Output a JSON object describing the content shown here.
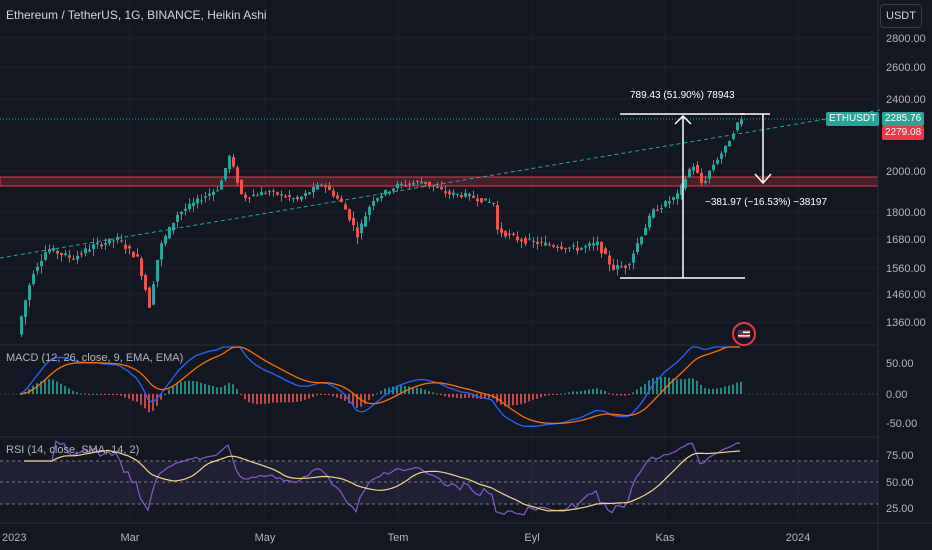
{
  "header": {
    "title": "Ethereum / TetherUS, 1G, BINANCE, Heikin Ashi",
    "currency_button": "USDT"
  },
  "indicators": {
    "macd_label": "MACD (12, 26, close, 9, EMA, EMA)",
    "rsi_label": "RSI (14, close, SMA, 14, 2)"
  },
  "axes": {
    "price_ticks": [
      "2800.00",
      "2600.00",
      "2400.00",
      "2000.00",
      "1800.00",
      "1680.00",
      "1560.00",
      "1460.00",
      "1360.00"
    ],
    "macd_ticks": [
      "50.00",
      "0.00",
      "-50.00"
    ],
    "rsi_ticks": [
      "75.00",
      "50.00",
      "25.00"
    ],
    "time_ticks": [
      "2023",
      "Mar",
      "May",
      "Tem",
      "Eyl",
      "Kas",
      "2024"
    ]
  },
  "price_tags": {
    "symbol": "ETHUSDT",
    "last": "2285.76",
    "close": "2279.08"
  },
  "measurements": {
    "up": "789.43 (51.90%) 78943",
    "down": "−381.97 (−16.53%) −38197"
  },
  "colors": {
    "bull": "#26a69a",
    "bear": "#ef5350",
    "macd": "#2962ff",
    "signal": "#ff6d00",
    "rsi": "#7e57c2",
    "rsi_ma": "#f5d48a",
    "zone": "#f23645",
    "trend": "#26a69a",
    "background": "#131722"
  },
  "chart_data": {
    "type": "candlestick",
    "symbol": "ETHUSDT",
    "waypoints": {
      "x": [
        0,
        20,
        35,
        50,
        75,
        95,
        120,
        140,
        152,
        162,
        180,
        205,
        222,
        232,
        245,
        270,
        300,
        325,
        345,
        360,
        375,
        400,
        425,
        450,
        470,
        497,
        500,
        520,
        545,
        580,
        600,
        615,
        630,
        655,
        680,
        695,
        705,
        715,
        728,
        742
      ],
      "price": [
        1200,
        1320,
        1540,
        1640,
        1600,
        1650,
        1680,
        1600,
        1420,
        1640,
        1790,
        1870,
        1920,
        2080,
        1870,
        1900,
        1860,
        1940,
        1840,
        1700,
        1860,
        1930,
        1950,
        1890,
        1880,
        1840,
        1720,
        1680,
        1660,
        1640,
        1660,
        1560,
        1570,
        1800,
        1880,
        2040,
        1930,
        2030,
        2130,
        2285
      ]
    },
    "resistance_zone": [
      1960,
      1995
    ],
    "trendline": [
      [
        0,
        1565
      ],
      [
        880,
        2310
      ]
    ],
    "measure_up": {
      "from": 1521,
      "to": 2310
    },
    "measure_down": {
      "from": 2310,
      "to": 1928
    },
    "macd_ylim": [
      -60,
      100
    ],
    "rsi_levels": [
      70,
      50,
      30
    ]
  }
}
